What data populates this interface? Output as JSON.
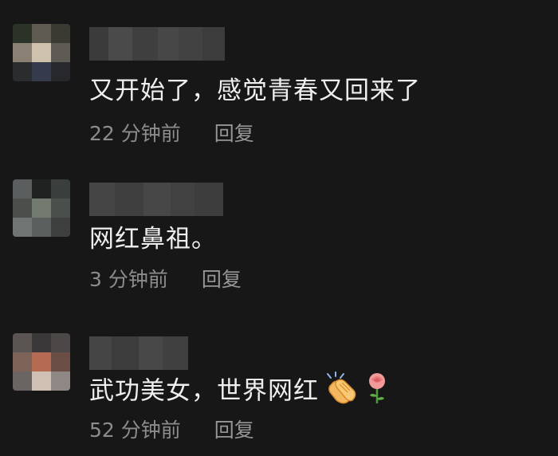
{
  "comments": [
    {
      "text": "又开始了，感觉青春又回来了",
      "time": "22 分钟前",
      "reply_label": "回复"
    },
    {
      "text": "网红鼻祖。",
      "time": "3 分钟前",
      "reply_label": "回复"
    },
    {
      "text": "武功美女，世界网红",
      "time": "52 分钟前",
      "reply_label": "回复",
      "emojis": [
        "clapping-hands-icon",
        "rose-icon"
      ]
    }
  ]
}
